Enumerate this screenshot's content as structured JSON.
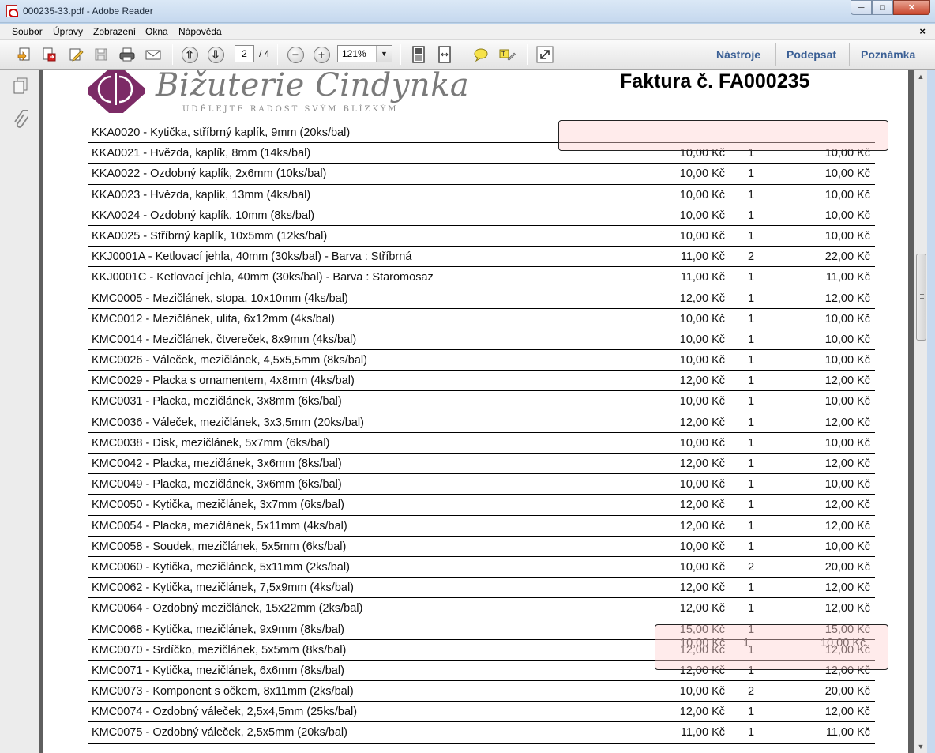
{
  "window": {
    "title": "000235-33.pdf - Adobe Reader",
    "min_icon": "minimize-icon",
    "max_icon": "maximize-icon",
    "close_icon": "close-icon"
  },
  "menu": {
    "items": [
      "Soubor",
      "Úpravy",
      "Zobrazení",
      "Okna",
      "Nápověda"
    ],
    "close_doc": "×"
  },
  "toolbar": {
    "page_current": "2",
    "page_total": "/ 4",
    "zoom": "121%",
    "tools_label": "Nástroje",
    "sign_label": "Podepsat",
    "comment_label": "Poznámka"
  },
  "document": {
    "logo_text": "Bižuterie Cindynka",
    "logo_tagline": "UDĚLEJTE RADOST SVÝM BLÍZKÝM",
    "invoice_title": "Faktura č. FA000235",
    "rows": [
      {
        "desc": "KKA0020 - Kytička, stříbrný kaplík, 9mm (20ks/bal)",
        "price": "",
        "qty": "",
        "total": ""
      },
      {
        "desc": "KKA0021 - Hvězda, kaplík, 8mm (14ks/bal)",
        "price": "10,00 Kč",
        "qty": "1",
        "total": "10,00 Kč"
      },
      {
        "desc": "KKA0022 - Ozdobný kaplík, 2x6mm (10ks/bal)",
        "price": "10,00 Kč",
        "qty": "1",
        "total": "10,00 Kč"
      },
      {
        "desc": "KKA0023 - Hvězda, kaplík, 13mm (4ks/bal)",
        "price": "10,00 Kč",
        "qty": "1",
        "total": "10,00 Kč"
      },
      {
        "desc": "KKA0024 - Ozdobný kaplík, 10mm (8ks/bal)",
        "price": "10,00 Kč",
        "qty": "1",
        "total": "10,00 Kč"
      },
      {
        "desc": "KKA0025 - Stříbrný kaplík, 10x5mm (12ks/bal)",
        "price": "10,00 Kč",
        "qty": "1",
        "total": "10,00 Kč"
      },
      {
        "desc": "KKJ0001A - Ketlovací jehla, 40mm (30ks/bal) - Barva : Stříbrná",
        "price": "11,00 Kč",
        "qty": "2",
        "total": "22,00 Kč"
      },
      {
        "desc": "KKJ0001C - Ketlovací jehla, 40mm (30ks/bal) - Barva : Staromosaz",
        "price": "11,00 Kč",
        "qty": "1",
        "total": "11,00 Kč"
      },
      {
        "desc": "KMC0005 - Mezičlánek, stopa, 10x10mm (4ks/bal)",
        "price": "12,00 Kč",
        "qty": "1",
        "total": "12,00 Kč"
      },
      {
        "desc": "KMC0012 - Mezičlánek, ulita, 6x12mm (4ks/bal)",
        "price": "10,00 Kč",
        "qty": "1",
        "total": "10,00 Kč"
      },
      {
        "desc": "KMC0014 - Mezičlánek, čtvereček, 8x9mm (4ks/bal)",
        "price": "10,00 Kč",
        "qty": "1",
        "total": "10,00 Kč"
      },
      {
        "desc": "KMC0026 - Váleček, mezičlánek, 4,5x5,5mm (8ks/bal)",
        "price": "10,00 Kč",
        "qty": "1",
        "total": "10,00 Kč"
      },
      {
        "desc": "KMC0029 - Placka s ornamentem, 4x8mm (4ks/bal)",
        "price": "12,00 Kč",
        "qty": "1",
        "total": "12,00 Kč"
      },
      {
        "desc": "KMC0031 - Placka, mezičlánek, 3x8mm (6ks/bal)",
        "price": "10,00 Kč",
        "qty": "1",
        "total": "10,00 Kč"
      },
      {
        "desc": "KMC0036 - Váleček, mezičlánek, 3x3,5mm (20ks/bal)",
        "price": "12,00 Kč",
        "qty": "1",
        "total": "12,00 Kč"
      },
      {
        "desc": "KMC0038 - Disk, mezičlánek, 5x7mm (6ks/bal)",
        "price": "10,00 Kč",
        "qty": "1",
        "total": "10,00 Kč"
      },
      {
        "desc": "KMC0042 - Placka, mezičlánek, 3x6mm (8ks/bal)",
        "price": "12,00 Kč",
        "qty": "1",
        "total": "12,00 Kč"
      },
      {
        "desc": "KMC0049 - Placka, mezičlánek, 3x6mm (6ks/bal)",
        "price": "10,00 Kč",
        "qty": "1",
        "total": "10,00 Kč"
      },
      {
        "desc": "KMC0050 - Kytička, mezičlánek, 3x7mm (6ks/bal)",
        "price": "12,00 Kč",
        "qty": "1",
        "total": "12,00 Kč"
      },
      {
        "desc": "KMC0054 - Placka, mezičlánek, 5x11mm (4ks/bal)",
        "price": "12,00 Kč",
        "qty": "1",
        "total": "12,00 Kč"
      },
      {
        "desc": "KMC0058 - Soudek, mezičlánek, 5x5mm (6ks/bal)",
        "price": "10,00 Kč",
        "qty": "1",
        "total": "10,00 Kč"
      },
      {
        "desc": "KMC0060 - Kytička, mezičlánek, 5x11mm (2ks/bal)",
        "price": "10,00 Kč",
        "qty": "2",
        "total": "20,00 Kč"
      },
      {
        "desc": "KMC0062 - Kytička, mezičlánek, 7,5x9mm (4ks/bal)",
        "price": "12,00 Kč",
        "qty": "1",
        "total": "12,00 Kč"
      },
      {
        "desc": "KMC0064 - Ozdobný mezičlánek, 15x22mm (2ks/bal)",
        "price": "12,00 Kč",
        "qty": "1",
        "total": "12,00 Kč"
      },
      {
        "desc": "KMC0068 - Kytička, mezičlánek, 9x9mm (8ks/bal)",
        "price": "15,00 Kč",
        "qty": "1",
        "total": "15,00 Kč"
      },
      {
        "desc": "KMC0070 - Srdíčko, mezičlánek, 5x5mm (8ks/bal)",
        "price": "12,00 Kč",
        "qty": "1",
        "total": "12,00 Kč"
      },
      {
        "desc": "KMC0071 - Kytička, mezičlánek, 6x6mm (8ks/bal)",
        "price": "12,00 Kč",
        "qty": "1",
        "total": "12,00 Kč"
      },
      {
        "desc": "KMC0073 - Komponent s očkem, 8x11mm (2ks/bal)",
        "price": "10,00 Kč",
        "qty": "2",
        "total": "20,00 Kč"
      },
      {
        "desc": "KMC0074 - Ozdobný váleček, 2,5x4,5mm (25ks/bal)",
        "price": "12,00 Kč",
        "qty": "1",
        "total": "12,00 Kč"
      },
      {
        "desc": "KMC0075 - Ozdobný váleček, 2,5x5mm (20ks/bal)",
        "price": "11,00 Kč",
        "qty": "1",
        "total": "11,00 Kč"
      }
    ],
    "ghost_overlay": {
      "price": "10,00 Kč",
      "qty": "1",
      "total": "10,00 Kč"
    }
  },
  "icons": {
    "left_nav": [
      "pages-icon",
      "attachment-icon"
    ],
    "toolbar": [
      "create-pdf-icon",
      "export-pdf-icon",
      "edit-icon",
      "save-icon",
      "print-icon",
      "email-icon",
      "page-up-icon",
      "page-down-icon",
      "zoom-out-icon",
      "zoom-in-icon",
      "fit-page-icon",
      "fit-width-icon",
      "comment-icon",
      "highlight-icon",
      "fullscreen-icon"
    ]
  }
}
